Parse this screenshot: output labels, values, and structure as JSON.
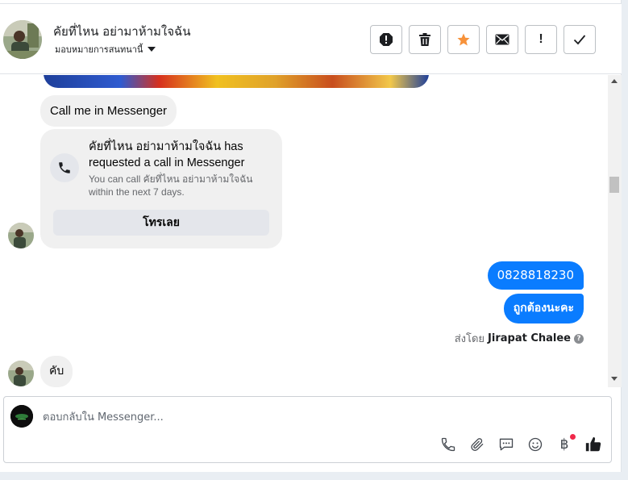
{
  "header": {
    "contact_name": "คัยที่ไหน อย่ามาห้ามใจฉัน",
    "assign_label": "มอบหมายการสนทนานี้",
    "toolbar": {
      "spam": "report-spam",
      "delete": "delete",
      "star": "star",
      "mark_unread": "mark-unread",
      "follow_up": "!",
      "done": "done"
    }
  },
  "messages": {
    "call_me_text": "Call me in Messenger",
    "call_card": {
      "title": "คัยที่ไหน อย่ามาห้ามใจฉัน has requested a call in Messenger",
      "subtitle": "You can call คัยที่ไหน อย่ามาห้ามใจฉัน within the next 7 days.",
      "button_label": "โทรเลย"
    },
    "outgoing": [
      "0828818230",
      "ถูกต้องนะคะ"
    ],
    "sent_by_prefix": "ส่งโดย",
    "sent_by_name": "Jirapat Chalee",
    "last_incoming": "คับ"
  },
  "composer": {
    "placeholder": "ตอบกลับใน Messenger..."
  },
  "colors": {
    "outgoing_bubble": "#0a7cff",
    "incoming_bubble": "#f0f0f0",
    "star": "#f7923a",
    "notification_dot": "#f02849"
  }
}
